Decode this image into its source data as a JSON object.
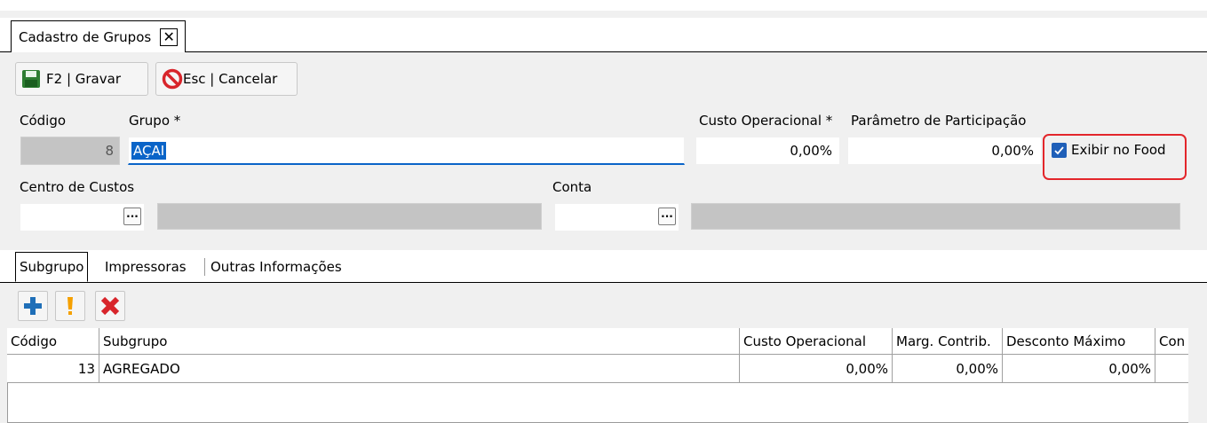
{
  "tab": {
    "title": "Cadastro de Grupos",
    "close_glyph": "✕"
  },
  "toolbar": {
    "save_label": "F2 | Gravar",
    "cancel_label": "Esc | Cancelar"
  },
  "form": {
    "codigo_label": "Código",
    "codigo_value": "8",
    "grupo_label": "Grupo *",
    "grupo_value": "AÇAI",
    "custo_label": "Custo Operacional *",
    "custo_value": "0,00%",
    "param_label": "Parâmetro de Participação",
    "param_value": "0,00%",
    "exibir_label": "Exibir no Food",
    "exibir_checked": true,
    "centro_label": "Centro de Custos",
    "conta_label": "Conta",
    "ellipsis": "···"
  },
  "subtabs": [
    "Subgrupo",
    "Impressoras",
    "Outras Informações"
  ],
  "grid": {
    "columns": [
      "Código",
      "Subgrupo",
      "Custo Operacional",
      "Marg. Contrib.",
      "Desconto Máximo",
      "Con"
    ],
    "rows": [
      {
        "codigo": "13",
        "subgrupo": "AGREGADO",
        "custo": "0,00%",
        "marg": "0,00%",
        "desconto": "0,00%",
        "con": ""
      }
    ]
  },
  "colors": {
    "highlight_border": "#e3262b",
    "check_blue": "#1f5fb8",
    "selection_blue": "#0a64c8",
    "cancel_red": "#d8252b",
    "save_green": "#2e7d32"
  },
  "icons": [
    "save-icon",
    "cancel-icon",
    "add-icon",
    "edit-icon",
    "delete-icon"
  ]
}
